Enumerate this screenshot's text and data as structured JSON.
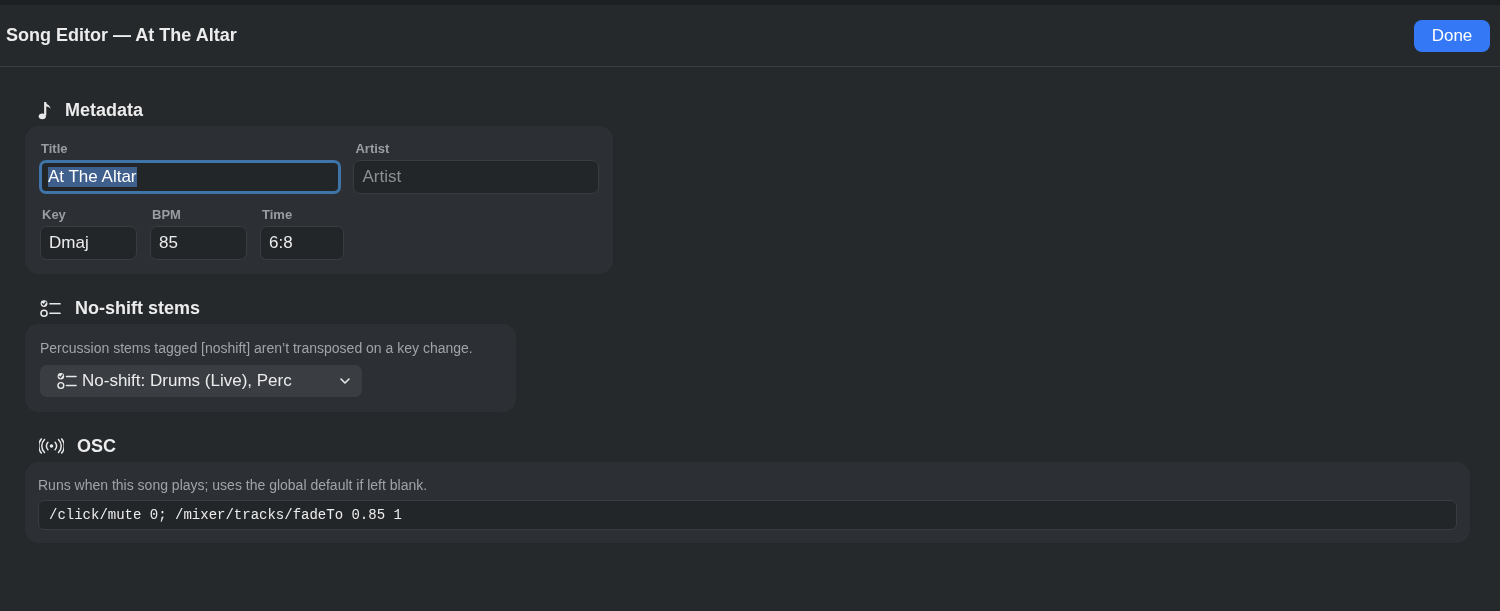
{
  "window": {
    "title": "Song Editor — At The Altar",
    "done_button": "Done"
  },
  "sections": [
    {
      "kind": "metadata",
      "heading": "Metadata",
      "rows": [
        [
          {
            "label": "Title",
            "value": "At The Altar",
            "focused": true,
            "text_selected": true
          },
          {
            "label": "Artist",
            "placeholder": "Artist",
            "focused": false,
            "text_selected": false
          }
        ],
        [
          {
            "label": "Key",
            "value": "Dmaj",
            "focused": false,
            "text_selected": false
          },
          {
            "label": "BPM",
            "value": "85",
            "focused": false,
            "text_selected": false
          },
          {
            "label": "Time",
            "value": "6:8",
            "focused": false,
            "text_selected": false
          }
        ]
      ]
    },
    {
      "kind": "stems",
      "heading": "No-shift stems",
      "description": "Percussion stems tagged [noshift] aren’t transposed on a key change.",
      "dropdown": "No-shift: Drums (Live), Perc"
    },
    {
      "kind": "osc",
      "heading": "OSC",
      "description": "Runs when this song plays; uses the global default if left blank.",
      "command": "/click/mute 0; /mixer/tracks/fadeTo 0.85 1"
    }
  ]
}
